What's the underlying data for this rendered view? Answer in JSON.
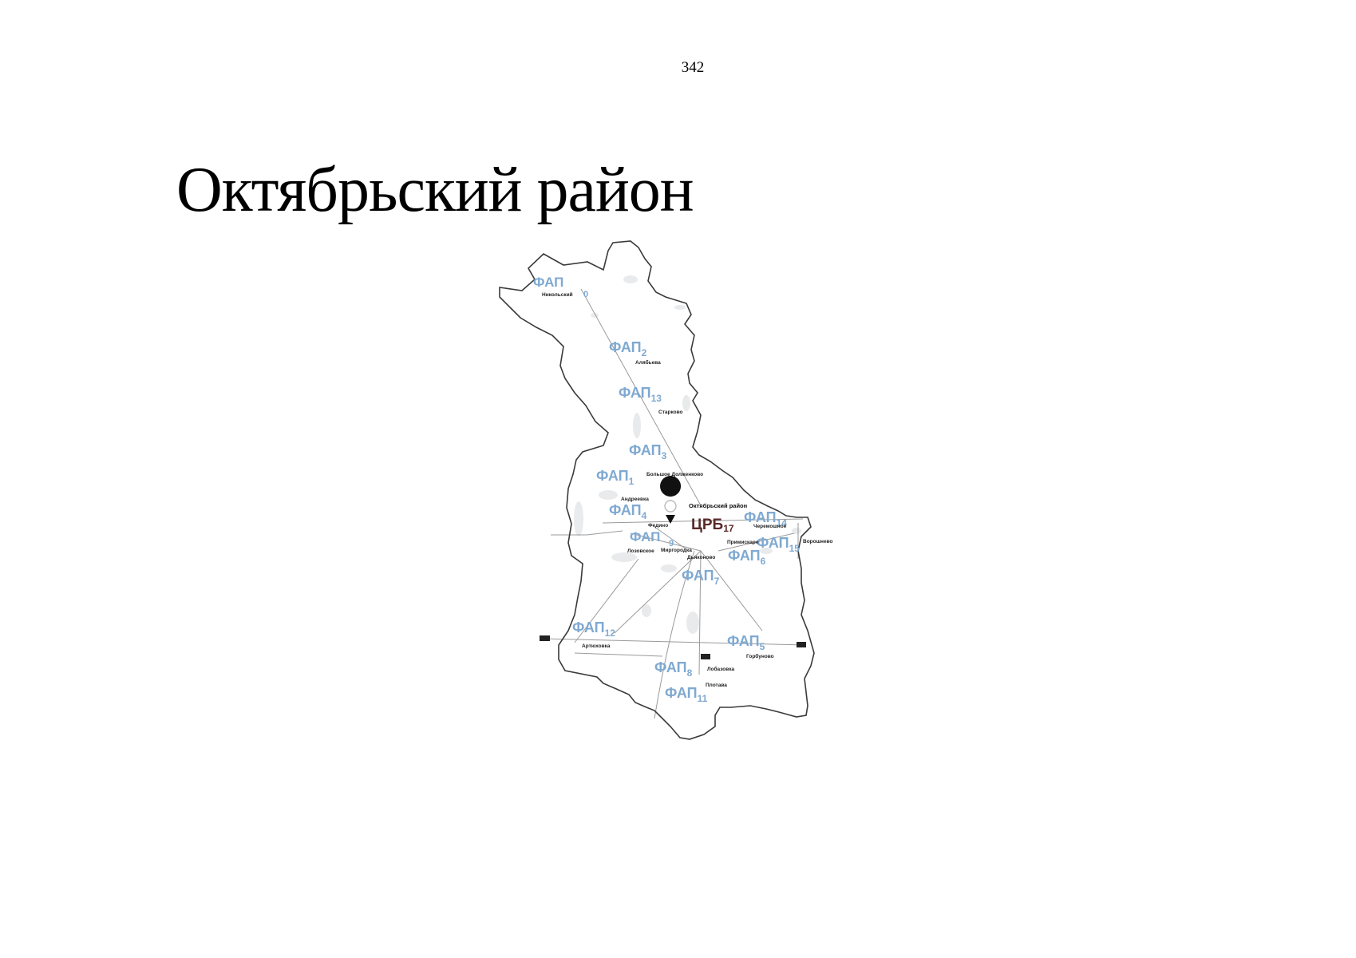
{
  "page_number": "342",
  "title": "Октябрьский район",
  "crb": {
    "label": "ЦРБ",
    "sub": "17",
    "place": "Октябрьский район"
  },
  "faps": [
    {
      "key": "fap0",
      "label": "ФАП",
      "sub": "0"
    },
    {
      "key": "fap2",
      "label": "ФАП",
      "sub": "2"
    },
    {
      "key": "fap13",
      "label": "ФАП",
      "sub": "13"
    },
    {
      "key": "fap3",
      "label": "ФАП",
      "sub": "3"
    },
    {
      "key": "fap1",
      "label": "ФАП",
      "sub": "1"
    },
    {
      "key": "fap4",
      "label": "ФАП",
      "sub": "4"
    },
    {
      "key": "fap9",
      "label": "ФАП",
      "sub": "9"
    },
    {
      "key": "fap14",
      "label": "ФАП",
      "sub": "14"
    },
    {
      "key": "fap15",
      "label": "ФАП",
      "sub": "15"
    },
    {
      "key": "fap6",
      "label": "ФАП",
      "sub": "6"
    },
    {
      "key": "fap7",
      "label": "ФАП",
      "sub": "7"
    },
    {
      "key": "fap12",
      "label": "ФАП",
      "sub": "12"
    },
    {
      "key": "fap5",
      "label": "ФАП",
      "sub": "5"
    },
    {
      "key": "fap8",
      "label": "ФАП",
      "sub": "8"
    },
    {
      "key": "fap11",
      "label": "ФАП",
      "sub": "11"
    }
  ],
  "villages": {
    "nikolsky": "Никольский",
    "alyabyeva": "Алябьева",
    "starkovo": "Старково",
    "bolshoe_dolzhenkovo": "Большое Долженково",
    "andreevka": "Андреевка",
    "fedino": "Федино",
    "lozovskoe": "Лозовское",
    "mirgorod": "Миргородка",
    "primiskaya": "Примискаре",
    "voroshnevo": "Ворошнево",
    "dyakonovo": "Дьяконово",
    "artyukhovka": "Артюховка",
    "gorbunovo": "Горбуново",
    "lobazovka": "Лобазовка",
    "plotava": "Плотава",
    "chermoshnoe": "Черемошное"
  }
}
